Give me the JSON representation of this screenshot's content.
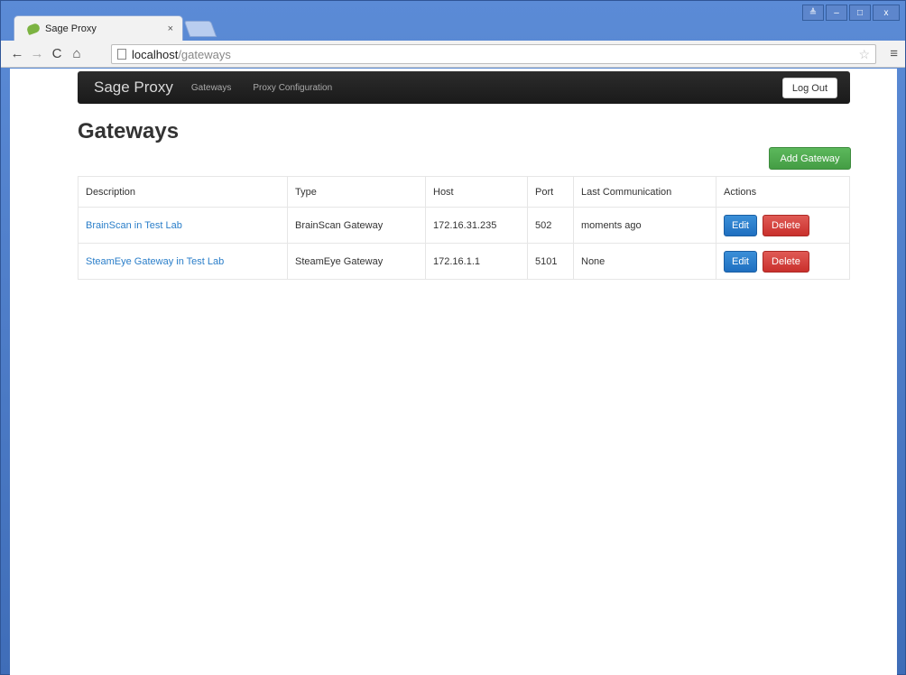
{
  "browser": {
    "tab_title": "Sage Proxy",
    "tab_close": "×",
    "url_host": "localhost",
    "url_path": "/gateways",
    "window_controls": [
      "≜",
      "–",
      "□",
      "x"
    ]
  },
  "navbar": {
    "brand": "Sage Proxy",
    "links": [
      "Gateways",
      "Proxy Configuration"
    ],
    "logout_label": "Log Out"
  },
  "page": {
    "title": "Gateways",
    "add_button_label": "Add Gateway"
  },
  "table": {
    "headers": [
      "Description",
      "Type",
      "Host",
      "Port",
      "Last Communication",
      "Actions"
    ],
    "rows": [
      {
        "description": "BrainScan in Test Lab",
        "type": "BrainScan Gateway",
        "host": "172.16.31.235",
        "port": "502",
        "last_communication": "moments ago",
        "edit_label": "Edit",
        "delete_label": "Delete"
      },
      {
        "description": "SteamEye Gateway in Test Lab",
        "type": "SteamEye Gateway",
        "host": "172.16.1.1",
        "port": "5101",
        "last_communication": "None",
        "edit_label": "Edit",
        "delete_label": "Delete"
      }
    ]
  },
  "colors": {
    "navbar": "#1a1a1a",
    "link": "#2a7ec9",
    "add_button": "#5cb85c",
    "edit_button": "#1f6fc0",
    "delete_button": "#c9302c"
  }
}
